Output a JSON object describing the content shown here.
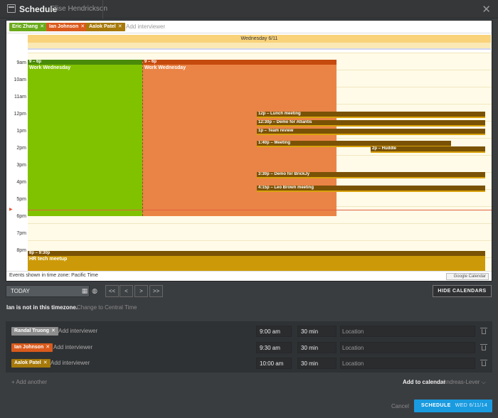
{
  "header": {
    "title": "Schedule",
    "subtitle": "Elise Hendrickson"
  },
  "calendar": {
    "chips": [
      {
        "label": "Eric Zhang",
        "color": "#6aaa1a"
      },
      {
        "label": "Ian Johnson",
        "color": "#d95a1c"
      },
      {
        "label": "Aalok Patel",
        "color": "#a6790a"
      }
    ],
    "add_interviewer_placeholder": "Add interviewer",
    "day_header": "Wednesday 6/11",
    "hours": [
      "9am",
      "10am",
      "11am",
      "12pm",
      "1pm",
      "2pm",
      "3pm",
      "4pm",
      "5pm",
      "6pm",
      "7pm",
      "8pm"
    ],
    "events": {
      "eric_work": {
        "time": "9 – 6p",
        "title": "Work Wednesday",
        "color": "#80c200",
        "head": "#4a8a0a"
      },
      "ian_work": {
        "time": "9 – 6p",
        "title": "Work Wednesday",
        "color": "#ea8446",
        "head": "#c54a0e"
      },
      "lunch": "12p – Lunch meeting",
      "demo_atlantis": "12:30p – Demo for Atlantis",
      "team_review": "1p – Team review",
      "meeting": "1:40p – Meeting",
      "huddle": "2p – Huddle",
      "demo_brickjy": "3:30p – Demo for BrickJy",
      "leo_brown": "4:15p – Leo Brown meeting",
      "hr_meetup": {
        "time": "8p – 9:30p",
        "title": "HR tech meetup"
      }
    },
    "timezone_note": "Events shown in time zone: Pacific Time",
    "google_calendar_label": "Google Calendar"
  },
  "controls": {
    "today": "TODAY",
    "nav": [
      "<<",
      "<",
      ">",
      ">>"
    ],
    "hide_calendars": "HIDE CALENDARS"
  },
  "tz_notice": {
    "message": "Ian is not in this timezone.",
    "action": "Change to Central Time"
  },
  "rows": [
    {
      "name": "Randal Truong",
      "color": "#8d8d8d",
      "add": "Add interviewer",
      "time": "9:00 am",
      "duration": "30 min",
      "location": "Location"
    },
    {
      "name": "Ian Johnson",
      "color": "#d95a1c",
      "add": "Add interviewer",
      "time": "9:30 am",
      "duration": "30 min",
      "location": "Location"
    },
    {
      "name": "Aalok Patel",
      "color": "#a6790a",
      "add": "Add interviewer",
      "time": "10:00 am",
      "duration": "30 min",
      "location": "Location"
    }
  ],
  "footer": {
    "add_another": "+ Add another",
    "add_to_calendar_label": "Add to calendar",
    "add_to_calendar_value": "Andreas-Lever",
    "cancel": "Cancel",
    "schedule_label": "SCHEDULE",
    "schedule_date": "WED 6/11/14"
  }
}
